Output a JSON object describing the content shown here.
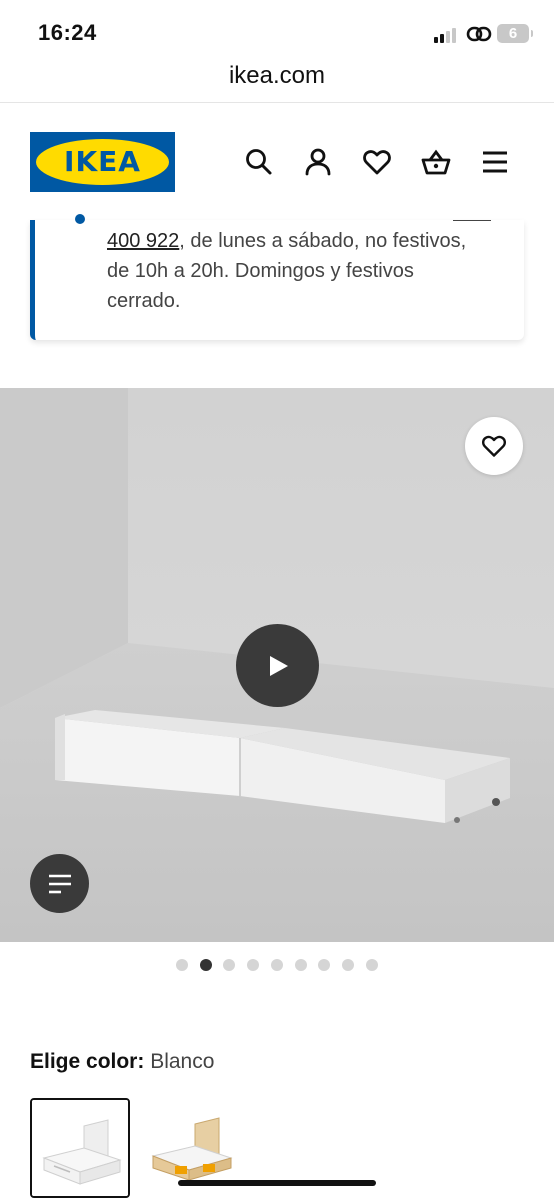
{
  "status_bar": {
    "time": "16:24",
    "battery": "6"
  },
  "browser": {
    "url": "ikea.com"
  },
  "header": {
    "logo_text": "IKEA",
    "icons": [
      "search-icon",
      "account-icon",
      "heart-icon",
      "basket-icon",
      "hamburger-menu-icon"
    ]
  },
  "info_card": {
    "phone_fragment": "400 922",
    "line1_rest": ", de lunes a sábado, no festivos,",
    "line2": "de 10h a 20h. Domingos y festivos",
    "line3": "cerrado."
  },
  "gallery": {
    "total_images": 9,
    "active_index": 1,
    "colors": {
      "wall": "#d6d6d6",
      "floor": "#c9c9c9",
      "drawer": "#f2f2f2",
      "button_dark": "#3a3a3a"
    }
  },
  "color_selector": {
    "label": "Elige color:",
    "selected": "Blanco",
    "options": [
      "white-bed-thumbnail",
      "oak-bed-thumbnail"
    ]
  }
}
